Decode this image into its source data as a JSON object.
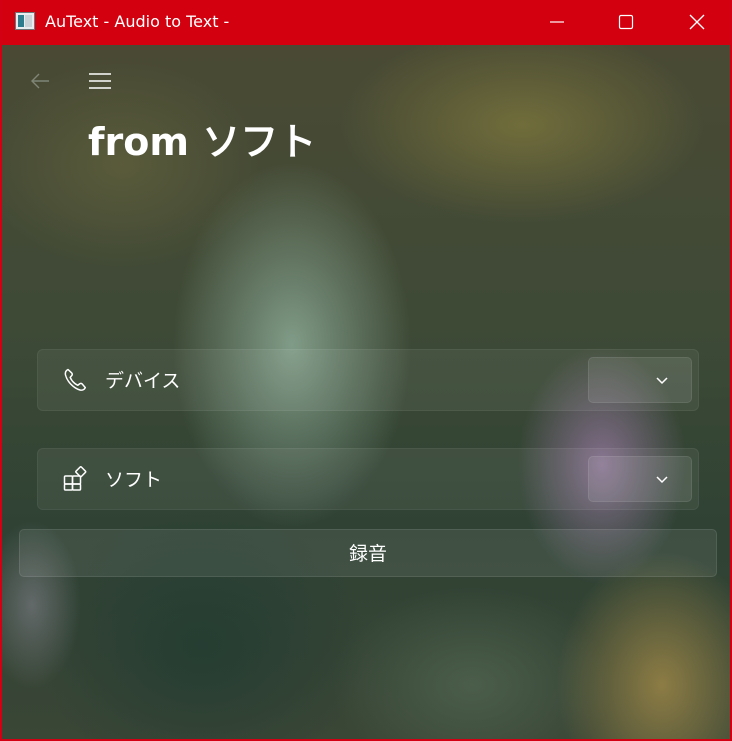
{
  "window": {
    "title": "AuText - Audio to Text -",
    "app_icon": "autext-app-icon",
    "accent_color": "#d3000f",
    "caption_icons": [
      "minimize-icon",
      "maximize-icon",
      "close-icon"
    ]
  },
  "nav": {
    "back_icon": "back-arrow-icon",
    "menu_icon": "hamburger-menu-icon"
  },
  "page": {
    "title": "from ソフト"
  },
  "settings": [
    {
      "label": "デバイス",
      "icon": "phone-icon",
      "combo_value": "",
      "combo_icon": "chevron-down-icon"
    },
    {
      "label": "ソフト",
      "icon": "apps-icon",
      "combo_value": "",
      "combo_icon": "chevron-down-icon"
    }
  ],
  "record_button": {
    "label": "録音"
  }
}
